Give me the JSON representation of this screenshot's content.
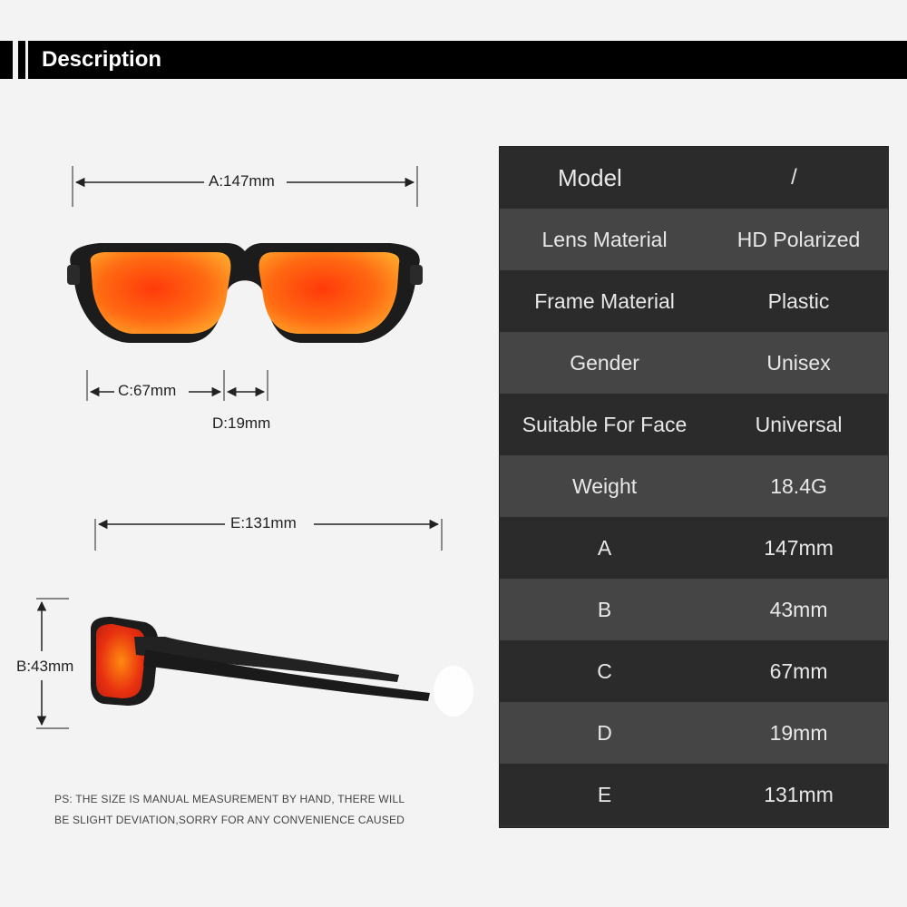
{
  "header": {
    "title": "Description"
  },
  "dimensions": {
    "a": "A:147mm",
    "c": "C:67mm",
    "d": "D:19mm",
    "e": "E:131mm",
    "b": "B:43mm"
  },
  "note": {
    "line1": "PS: THE SIZE IS MANUAL MEASUREMENT BY HAND, THERE WILL",
    "line2": "BE SLIGHT DEVIATION,SORRY FOR ANY CONVENIENCE CAUSED"
  },
  "specs": [
    {
      "key": "Model",
      "value": "/"
    },
    {
      "key": "Lens Material",
      "value": "HD Polarized"
    },
    {
      "key": "Frame Material",
      "value": "Plastic"
    },
    {
      "key": "Gender",
      "value": "Unisex"
    },
    {
      "key": "Suitable For Face",
      "value": "Universal"
    },
    {
      "key": "Weight",
      "value": "18.4G"
    },
    {
      "key": "A",
      "value": "147mm"
    },
    {
      "key": "B",
      "value": "43mm"
    },
    {
      "key": "C",
      "value": "67mm"
    },
    {
      "key": "D",
      "value": "19mm"
    },
    {
      "key": "E",
      "value": "131mm"
    }
  ],
  "colors": {
    "lens": "#ff5a14",
    "frame": "#1c1c1c",
    "table_dark": "#2b2b2b",
    "table_light": "#454545"
  }
}
